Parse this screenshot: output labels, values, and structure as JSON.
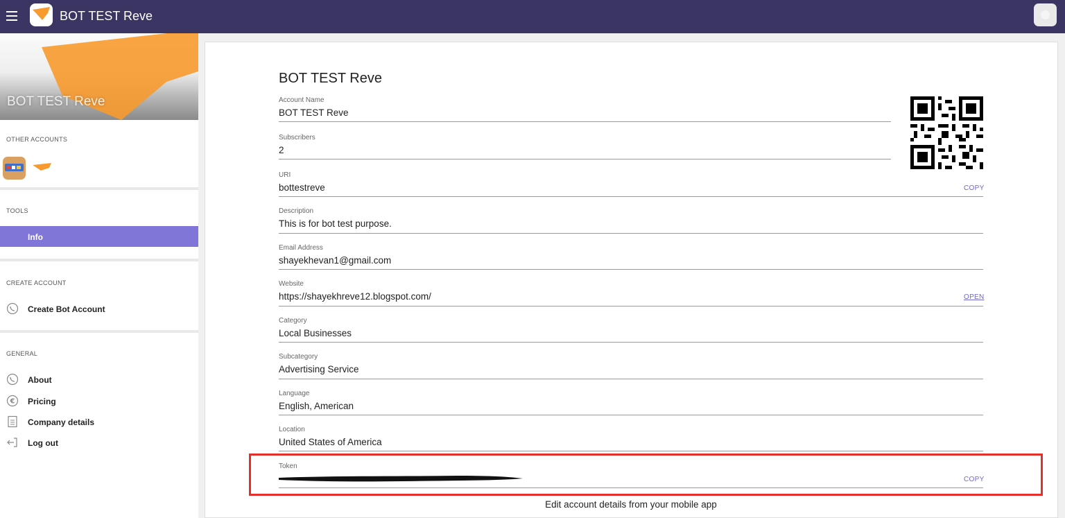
{
  "header": {
    "app_title": "BOT TEST Reve",
    "menu_icon": "hamburger-menu-icon",
    "logo_icon": "bot-logo-icon",
    "avatar_icon": "user-avatar-icon",
    "background_color": "#3b3563"
  },
  "sidebar": {
    "account_name": "BOT TEST Reve",
    "other_accounts_label": "OTHER ACCOUNTS",
    "tools_label": "TOOLS",
    "tools_items": [
      {
        "label": "Info",
        "active": true
      }
    ],
    "create_account_label": "CREATE ACCOUNT",
    "create_items": [
      {
        "label": "Create Bot Account",
        "icon": "viber-phone-icon"
      }
    ],
    "general_label": "GENERAL",
    "general_items": [
      {
        "label": "About",
        "icon": "viber-phone-icon"
      },
      {
        "label": "Pricing",
        "icon": "euro-icon"
      },
      {
        "label": "Company details",
        "icon": "document-icon"
      },
      {
        "label": "Log out",
        "icon": "logout-icon"
      }
    ],
    "active_color": "#7f76d8"
  },
  "main": {
    "title": "BOT TEST Reve",
    "fields": [
      {
        "label": "Account Name",
        "value": "BOT TEST Reve"
      },
      {
        "label": "Subscribers",
        "value": "2"
      },
      {
        "label": "URI",
        "value": "bottestreve",
        "action": "COPY"
      },
      {
        "label": "Description",
        "value": "This is for bot test purpose."
      },
      {
        "label": "Email Address",
        "value": "shayekhevan1@gmail.com"
      },
      {
        "label": "Website",
        "value": "https://shayekhreve12.blogspot.com/",
        "action": "OPEN"
      },
      {
        "label": "Category",
        "value": "Local Businesses"
      },
      {
        "label": "Subcategory",
        "value": "Advertising Service"
      },
      {
        "label": "Language",
        "value": "English, American"
      },
      {
        "label": "Location",
        "value": "United States of America"
      },
      {
        "label": "Token",
        "value": "",
        "action": "COPY"
      }
    ],
    "qr_icon": "qr-code-icon",
    "footer_note": "Edit account details from your mobile app",
    "accent_color": "#6e68c9",
    "highlight_color": "#e3302a"
  }
}
